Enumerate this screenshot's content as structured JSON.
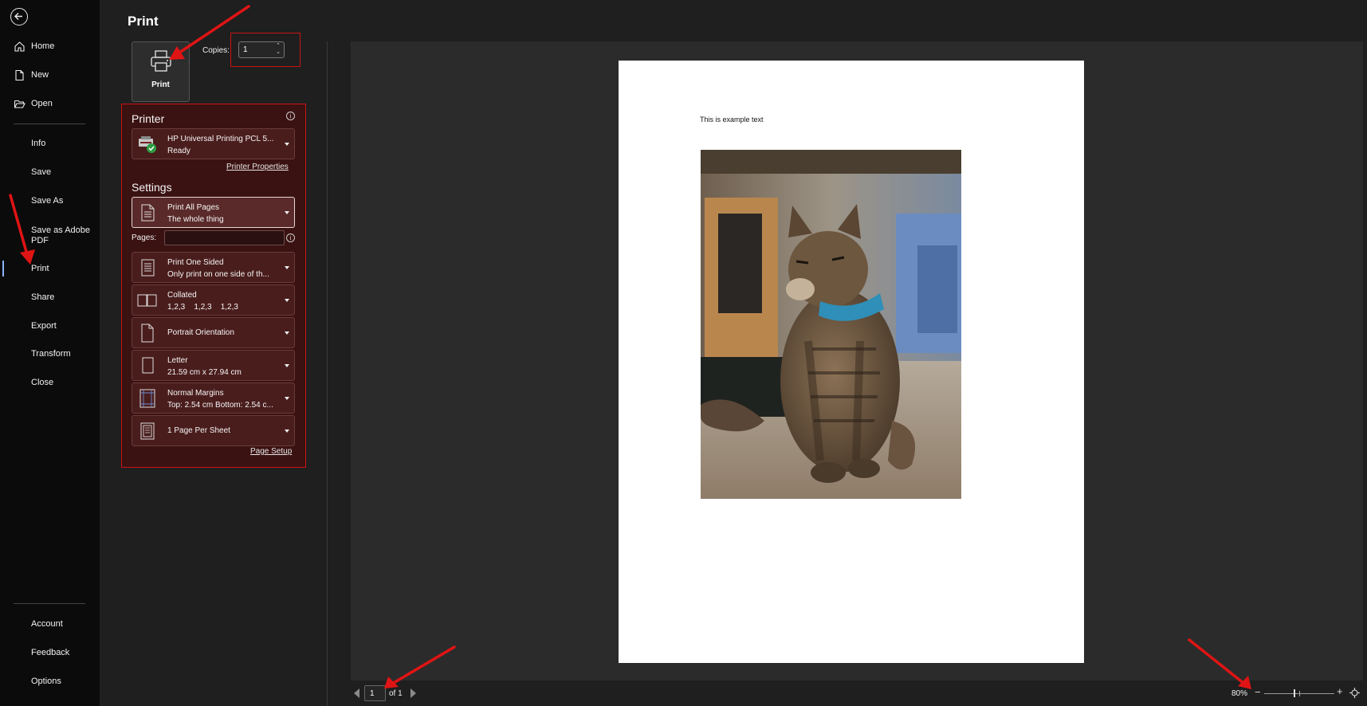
{
  "nav": {
    "items": [
      {
        "label": "Home",
        "icon": "home-icon"
      },
      {
        "label": "New",
        "icon": "new-document-icon"
      },
      {
        "label": "Open",
        "icon": "folder-open-icon"
      },
      {
        "label": "Info"
      },
      {
        "label": "Save"
      },
      {
        "label": "Save As"
      },
      {
        "label": "Save as Adobe PDF"
      },
      {
        "label": "Print",
        "selected": true
      },
      {
        "label": "Share"
      },
      {
        "label": "Export"
      },
      {
        "label": "Transform"
      },
      {
        "label": "Close"
      }
    ],
    "bottom": [
      {
        "label": "Account"
      },
      {
        "label": "Feedback"
      },
      {
        "label": "Options"
      }
    ]
  },
  "print": {
    "title": "Print",
    "print_button_label": "Print",
    "copies_label": "Copies:",
    "copies_value": "1"
  },
  "printer": {
    "section_title": "Printer",
    "name": "HP Universal Printing PCL 5...",
    "status": "Ready",
    "properties_link": "Printer Properties"
  },
  "settings": {
    "section_title": "Settings",
    "pages_label": "Pages:",
    "pages_value": "",
    "dropdowns": [
      {
        "line1": "Print All Pages",
        "line2": "The whole thing",
        "icon": "pages-icon"
      },
      {
        "line1": "Print One Sided",
        "line2": "Only print on one side of th...",
        "icon": "one-sided-icon"
      },
      {
        "line1": "Collated",
        "line2": "1,2,3    1,2,3    1,2,3",
        "icon": "collated-icon"
      },
      {
        "line1": "Portrait Orientation",
        "line2": "",
        "icon": "portrait-icon"
      },
      {
        "line1": "Letter",
        "line2": "21.59 cm x 27.94 cm",
        "icon": "paper-size-icon"
      },
      {
        "line1": "Normal Margins",
        "line2": "Top: 2.54 cm Bottom: 2.54 c...",
        "icon": "margins-icon"
      },
      {
        "line1": "1 Page Per Sheet",
        "line2": "",
        "icon": "pages-per-sheet-icon"
      }
    ],
    "page_setup_link": "Page Setup"
  },
  "preview": {
    "document_text": "This is example text",
    "page_current": "1",
    "page_of": "of 1",
    "zoom": "80%",
    "zoom_level_fraction": 0.43
  },
  "colors": {
    "highlight_red": "#c81414",
    "panel_bg": "#3b1212",
    "nav_bg": "#0b0b0b",
    "selected_indicator": "#8ab4f8"
  }
}
